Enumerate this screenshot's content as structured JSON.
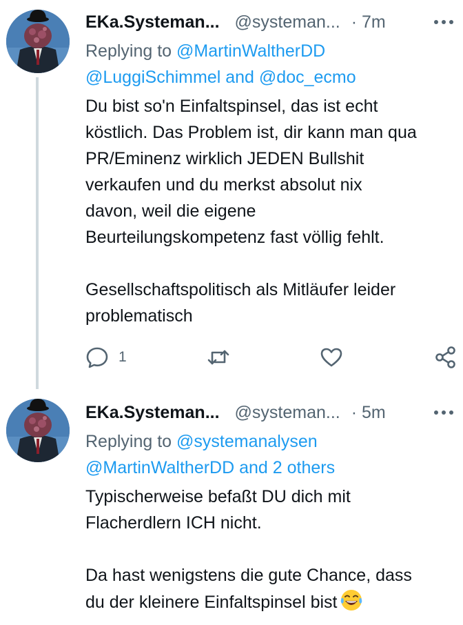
{
  "tweets": [
    {
      "display_name": "EKa.Systeman...",
      "handle": "@systeman...",
      "time": "· 7m",
      "reply_prefix": "Replying to",
      "reply_mentions_line1": "@MartinWaltherDD",
      "reply_mentions_line2_a": "@LuggiSchimmel",
      "reply_mentions_line2_and": "and",
      "reply_mentions_line2_b": "@doc_ecmo",
      "body_lines": [
        "Du bist so'n Einfaltspinsel, das ist echt",
        "köstlich. Das Problem ist, dir kann man qua",
        "PR/Eminenz wirklich JEDEN Bullshit",
        "verkaufen und du merkst absolut nix",
        "davon, weil die eigene",
        "Beurteilungskompetenz fast völlig fehlt.",
        "Gesellschaftspolitisch als Mitläufer leider",
        "problematisch"
      ],
      "reply_count": "1",
      "icons": [
        "reply-icon",
        "retweet-icon",
        "like-icon",
        "share-icon",
        "more-icon"
      ]
    },
    {
      "display_name": "EKa.Systeman...",
      "handle": "@systeman...",
      "time": "· 5m",
      "reply_prefix": "Replying to",
      "reply_mentions_line1": "@systemanalysen",
      "reply_mentions_line2_a": "@MartinWaltherDD",
      "reply_mentions_line2_and": "and",
      "reply_mentions_line2_b": "2 others",
      "body_lines": [
        "Typischerweise befaßt DU dich mit",
        "Flacherdlern ICH nicht.",
        "Da hast wenigstens die gute Chance, dass",
        "du der kleinere Einfaltspinsel bist"
      ],
      "emoji": "face-with-tears-of-joy",
      "icons": [
        "more-icon"
      ]
    }
  ],
  "colors": {
    "text": "#0f1419",
    "secondary": "#536471",
    "link": "#1d9bf0",
    "thread_line": "#cfd9de"
  }
}
